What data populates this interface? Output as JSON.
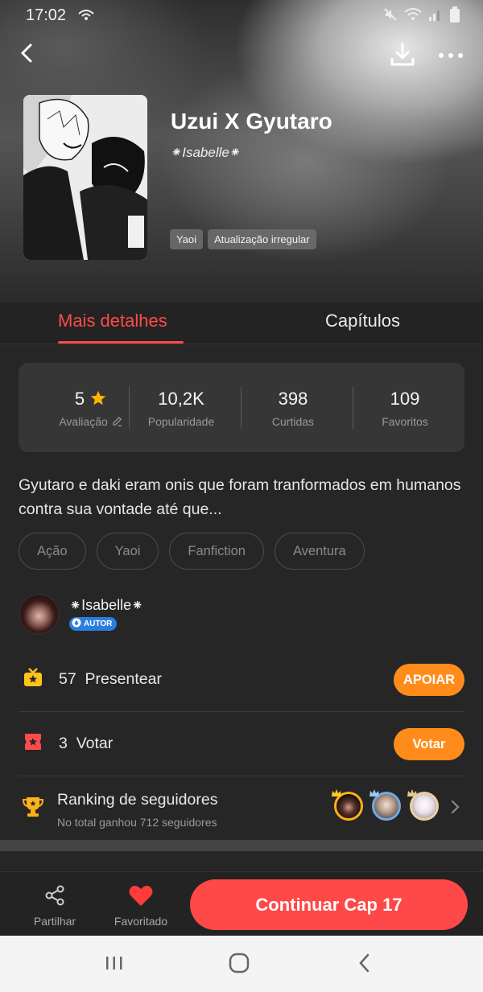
{
  "status_bar": {
    "time": "17:02"
  },
  "header": {
    "back_icon": "back-icon",
    "download_icon": "download-icon",
    "more_icon": "more-icon"
  },
  "book": {
    "title": "Uzui X Gyutaro",
    "author": "⁕Isabelle⁕",
    "tags": [
      "Yaoi",
      "Atualização irregular"
    ]
  },
  "tabs": [
    {
      "label": "Mais detalhes",
      "active": true
    },
    {
      "label": "Capítulos",
      "active": false
    }
  ],
  "stats": {
    "rating_value": "5",
    "rating_label": "Avaliação",
    "popularity_value": "10,2K",
    "popularity_label": "Popularidade",
    "likes_value": "398",
    "likes_label": "Curtidas",
    "favorites_value": "109",
    "favorites_label": "Favoritos"
  },
  "description": "Gyutaro e daki eram onis que foram tranformados em humanos contra sua vontade até que...",
  "genres": [
    "Ação",
    "Yaoi",
    "Fanfiction",
    "Aventura"
  ],
  "author_block": {
    "name": "⁕Isabelle⁕",
    "badge": "AUTOR"
  },
  "gift": {
    "count": "57",
    "label": "Presentear",
    "button": "APOIAR"
  },
  "vote": {
    "count": "3",
    "label": "Votar",
    "button": "Votar"
  },
  "ranking": {
    "title": "Ranking de seguidores",
    "subtitle": "No total ganhou 712 seguidores"
  },
  "bottom": {
    "share_label": "Partilhar",
    "favorite_label": "Favoritado",
    "continue_label": "Continuar Cap 17"
  },
  "colors": {
    "accent_red": "#ff4b4b",
    "accent_orange": "#ff8c1a",
    "badge_blue": "#2c7de0"
  }
}
